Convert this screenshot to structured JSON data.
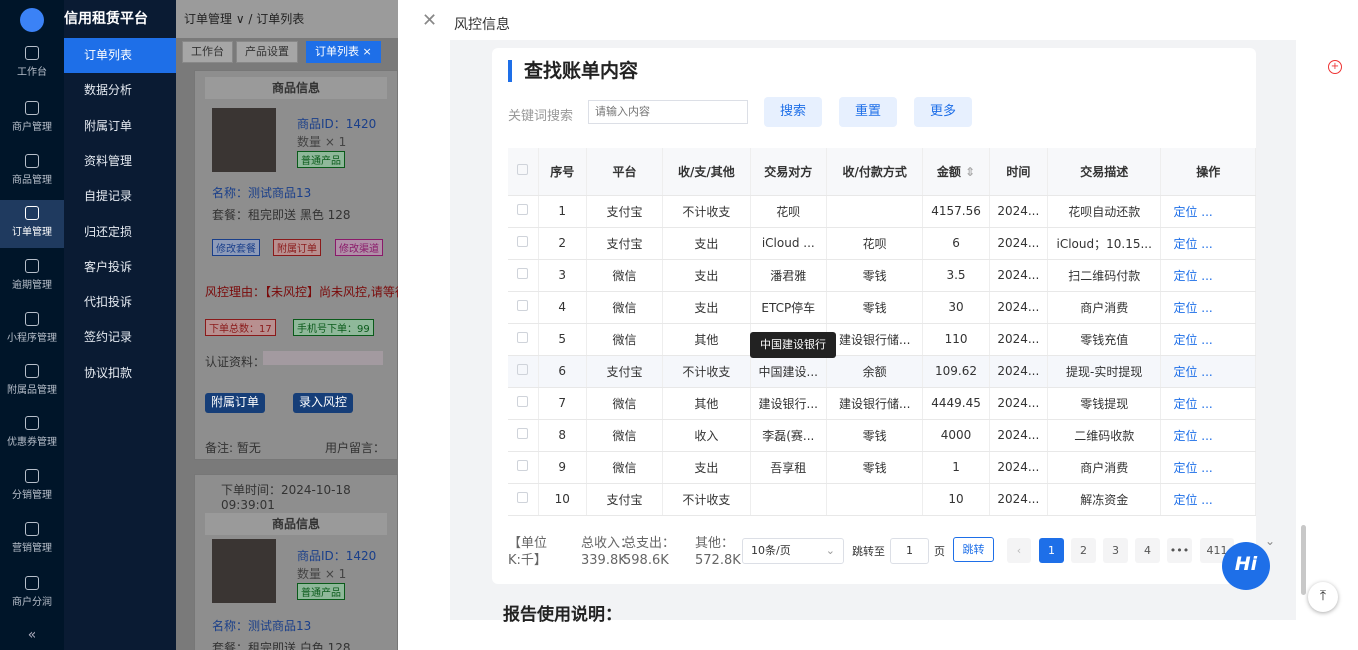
{
  "rail": {
    "items": [
      "工作台",
      "商户管理",
      "商品管理",
      "订单管理",
      "逾期管理",
      "小程序管理",
      "附属品管理",
      "优惠券管理",
      "分销管理",
      "营销管理",
      "商户分润"
    ],
    "collapse": "«"
  },
  "submenu": {
    "brand": "信用租赁平台",
    "items": [
      "订单列表",
      "数据分析",
      "附属订单",
      "资料管理",
      "自提记录",
      "归还定损",
      "客户投诉",
      "代扣投诉",
      "签约记录",
      "协议扣款"
    ]
  },
  "breadcrumb": {
    "parent": "订单管理 ∨",
    "current": "订单列表"
  },
  "tabs": [
    "工作台",
    "产品设置",
    "订单列表 ×"
  ],
  "order1": {
    "product_header": "商品信息",
    "product_id": "商品ID：1420",
    "qty": "数量 × 1",
    "tag": "普通产品",
    "name": "名称：测试商品13",
    "plan": "套餐：租完即送 黑色 128",
    "btns": [
      "修改套餐",
      "附属订单",
      "修改渠道"
    ],
    "risk": "风控理由：【未风控】尚未风控,请等待",
    "counts": [
      "下单总数：17",
      "手机号下单：99"
    ],
    "auth": "认证资料：",
    "actions": [
      "附属订单",
      "录入风控"
    ],
    "remark": "备注: 暂无",
    "msg": "用户留言："
  },
  "order2": {
    "time": "下单时间：2024-10-18 09:39:01",
    "product_header": "商品信息",
    "product_id": "商品ID：1420",
    "qty": "数量 × 1",
    "tag": "普通产品",
    "name": "名称：测试商品13",
    "plan": "套餐：租完即送 白色 128"
  },
  "drawer": {
    "title": "风控信息",
    "panel_title": "查找账单内容",
    "kw_label": "关键词搜索",
    "kw_placeholder": "请输入内容",
    "btn_search": "搜索",
    "btn_reset": "重置",
    "btn_more": "更多",
    "headers": [
      "序号",
      "平台",
      "收/支/其他",
      "交易对方",
      "收/付款方式",
      "金额",
      "时间",
      "交易描述",
      "操作"
    ],
    "rows": [
      [
        "1",
        "支付宝",
        "不计收支",
        "花呗",
        "",
        "4157.56",
        "2024...",
        "花呗自动还款",
        "定位 ..."
      ],
      [
        "2",
        "支付宝",
        "支出",
        "iCloud ...",
        "花呗",
        "6",
        "2024...",
        "iCloud；10.15...",
        "定位 ..."
      ],
      [
        "3",
        "微信",
        "支出",
        "潘君雅",
        "零钱",
        "3.5",
        "2024...",
        "扫二维码付款",
        "定位 ..."
      ],
      [
        "4",
        "微信",
        "支出",
        "ETCP停车",
        "零钱",
        "30",
        "2024...",
        "商户消费",
        "定位 ..."
      ],
      [
        "5",
        "微信",
        "其他",
        "",
        "建设银行储...",
        "110",
        "2024...",
        "零钱充值",
        "定位 ..."
      ],
      [
        "6",
        "支付宝",
        "不计收支",
        "中国建设...",
        "余额",
        "109.62",
        "2024...",
        "提现-实时提现",
        "定位 ..."
      ],
      [
        "7",
        "微信",
        "其他",
        "建设银行...",
        "建设银行储...",
        "4449.45",
        "2024...",
        "零钱提现",
        "定位 ..."
      ],
      [
        "8",
        "微信",
        "收入",
        "李磊(赛...",
        "零钱",
        "4000",
        "2024...",
        "二维码收款",
        "定位 ..."
      ],
      [
        "9",
        "微信",
        "支出",
        "吾享租",
        "零钱",
        "1",
        "2024...",
        "商户消费",
        "定位 ..."
      ],
      [
        "10",
        "支付宝",
        "不计收支",
        "",
        "",
        "10",
        "2024...",
        "解冻资金",
        "定位 ..."
      ]
    ],
    "tooltip": "中国建设银行",
    "summary": {
      "unit": "【单位K:千】",
      "income_label": "总收入：",
      "income": "339.8K",
      "expense_label": "总支出：",
      "expense": "598.6K",
      "other_label": "其他：",
      "other": "572.8K"
    },
    "page_size": "10条/页",
    "jump_label": "跳转至",
    "jump_value": "1",
    "jump_unit": "页",
    "jump_btn": "跳转",
    "pages": [
      "1",
      "2",
      "3",
      "4",
      "•••",
      "411"
    ],
    "usage_title": "报告使用说明："
  },
  "hi": "Hi"
}
